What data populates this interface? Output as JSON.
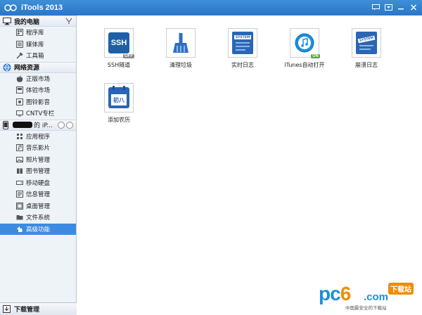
{
  "titlebar": {
    "app_title": "iTools 2013",
    "buttons": [
      {
        "icon": "feedback-icon"
      },
      {
        "icon": "menu-icon"
      },
      {
        "icon": "minimize-icon"
      },
      {
        "icon": "close-icon"
      }
    ]
  },
  "sidebar": {
    "my_computer": {
      "label": "我的电脑",
      "items": [
        {
          "label": "程序库",
          "icon": "app-library-icon"
        },
        {
          "label": "媒体库",
          "icon": "media-library-icon"
        },
        {
          "label": "工具箱",
          "icon": "toolbox-icon"
        }
      ]
    },
    "online": {
      "label": "网络资源",
      "items": [
        {
          "label": "正版市场",
          "icon": "apple-icon"
        },
        {
          "label": "体验市场",
          "icon": "store-icon"
        },
        {
          "label": "图铃影音",
          "icon": "media-icon"
        },
        {
          "label": "CNTV专栏",
          "icon": "tv-icon"
        }
      ]
    },
    "device": {
      "label": "的 iP...",
      "items": [
        {
          "label": "应用程序",
          "icon": "apps-icon"
        },
        {
          "label": "音乐影片",
          "icon": "music-icon"
        },
        {
          "label": "照片管理",
          "icon": "photo-icon"
        },
        {
          "label": "图书管理",
          "icon": "book-icon"
        },
        {
          "label": "移动硬盘",
          "icon": "disk-icon"
        },
        {
          "label": "信息管理",
          "icon": "message-icon"
        },
        {
          "label": "桌面管理",
          "icon": "desktop-icon"
        },
        {
          "label": "文件系统",
          "icon": "folder-icon"
        },
        {
          "label": "高级功能",
          "icon": "advanced-icon"
        }
      ],
      "active_index": 8
    },
    "download": {
      "label": "下载管理"
    }
  },
  "main": {
    "tiles": [
      {
        "label": "SSH隧道",
        "badge": "OFF",
        "icon_text": "SSH"
      },
      {
        "label": "清理垃圾",
        "badge": "",
        "icon_text": ""
      },
      {
        "label": "实时日志",
        "badge": "",
        "icon_text": "SYSTEM"
      },
      {
        "label": "iTunes自动打开",
        "badge": "ON",
        "icon_text": ""
      },
      {
        "label": "崩溃日志",
        "badge": "",
        "icon_text": "SYSTEM"
      },
      {
        "label": "添加农历",
        "badge": "",
        "icon_text": "初八"
      }
    ]
  },
  "watermark": {
    "brand_a": "pc",
    "brand_b": "6",
    "brand_c": ".com",
    "xiazaizhan": "下载站",
    "tagline": "中国最安全的下载站"
  },
  "colors": {
    "titlebar": "#2a76c6",
    "active": "#3d8be0",
    "ssh": "#1f5fa8",
    "broom": "#2d6fc2",
    "itunes": "#1a8fe0",
    "on_badge": "#56a33a",
    "brand": "#1e8fd6",
    "brand_accent": "#f08c00"
  }
}
